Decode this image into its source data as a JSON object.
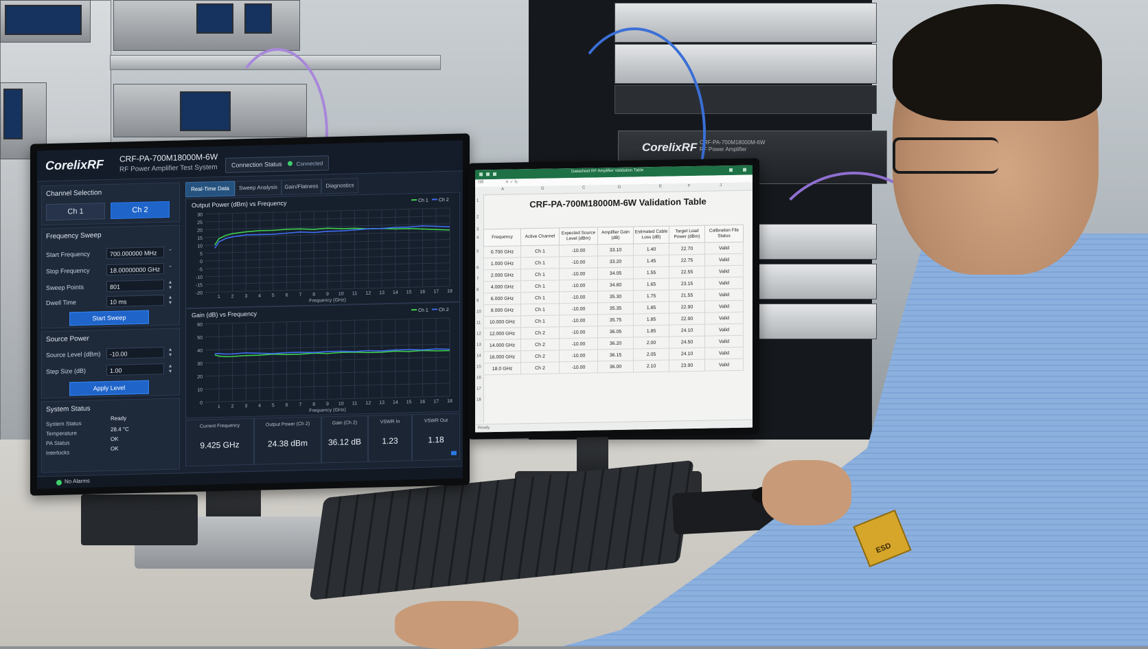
{
  "left_monitor": {
    "header": {
      "logo": "CorelixRF",
      "model": "CRF-PA-700M18000M-6W",
      "subtitle": "RF Power Amplifier Test System",
      "connection_label": "Connection Status",
      "connection_value": "Connected"
    },
    "channel_selection": {
      "title": "Channel Selection",
      "ch1": "Ch 1",
      "ch2": "Ch 2",
      "active": "Ch 2"
    },
    "frequency_sweep": {
      "title": "Frequency Sweep",
      "fields": [
        {
          "label": "Start Frequency",
          "value": "700.000000 MHz"
        },
        {
          "label": "Stop Frequency",
          "value": "18.00000000 GHz"
        },
        {
          "label": "Sweep Points",
          "value": "801"
        },
        {
          "label": "Dwell Time",
          "value": "10 ms"
        }
      ],
      "button": "Start Sweep"
    },
    "source_power": {
      "title": "Source Power",
      "fields": [
        {
          "label": "Source Level (dBm)",
          "value": "-10.00"
        },
        {
          "label": "Step Size (dB)",
          "value": "1.00"
        }
      ],
      "button": "Apply Level"
    },
    "system_status": {
      "title": "System Status",
      "rows": [
        {
          "label": "System Status",
          "value": "Ready"
        },
        {
          "label": "Temperature",
          "value": "28.4 °C"
        },
        {
          "label": "PA Status",
          "value": "OK"
        },
        {
          "label": "Interlocks",
          "value": "OK"
        }
      ]
    },
    "tabs": [
      "Real-Time Data",
      "Sweep Analysis",
      "Gain/Flatness",
      "Diagnostics"
    ],
    "readouts": [
      {
        "label": "Current Frequency",
        "value": "9.425 GHz"
      },
      {
        "label": "Output Power (Ch 2)",
        "value": "24.38 dBm"
      },
      {
        "label": "Gain (Ch 2)",
        "value": "36.12 dB"
      },
      {
        "label": "VSWR In",
        "value": "1.23"
      },
      {
        "label": "VSWR Out",
        "value": "1.18"
      }
    ],
    "footer": {
      "alarm": "No Alarms"
    }
  },
  "chart_data": [
    {
      "type": "line",
      "title": "Output Power (dBm) vs Frequency",
      "xlabel": "Frequency (GHz)",
      "ylabel": "",
      "xlim": [
        0,
        18
      ],
      "ylim": [
        -20,
        30
      ],
      "xticks": [
        1,
        2,
        3,
        4,
        5,
        6,
        7,
        8,
        9,
        10,
        11,
        12,
        13,
        14,
        15,
        16,
        17,
        18
      ],
      "yticks": [
        30,
        25,
        20,
        15,
        10,
        5,
        0,
        -5,
        -10,
        -15,
        -20
      ],
      "legend": "top-right",
      "grid": true,
      "x": [
        0.7,
        1,
        1.5,
        2,
        3,
        4,
        5,
        6,
        7,
        8,
        9,
        10,
        11,
        12,
        13,
        14,
        15,
        16,
        17,
        18
      ],
      "series": [
        {
          "name": "Ch 1",
          "color": "#3fd04f",
          "values": [
            10,
            14,
            16,
            17,
            18,
            18.5,
            18.5,
            19,
            19,
            18.5,
            19,
            18.5,
            18.5,
            18,
            18,
            17.5,
            17.5,
            17,
            16.5,
            16
          ]
        },
        {
          "name": "Ch 2",
          "color": "#3f6df0",
          "values": [
            8,
            12,
            14,
            15,
            16,
            16,
            16,
            16.5,
            17,
            16.5,
            17,
            17,
            17.5,
            18,
            18,
            18.5,
            18.5,
            19,
            18.5,
            18
          ]
        }
      ]
    },
    {
      "type": "line",
      "title": "Gain (dB) vs Frequency",
      "xlabel": "Frequency (GHz)",
      "ylabel": "",
      "xlim": [
        0,
        18
      ],
      "ylim": [
        0,
        60
      ],
      "xticks": [
        1,
        2,
        3,
        4,
        5,
        6,
        7,
        8,
        9,
        10,
        11,
        12,
        13,
        14,
        15,
        16,
        17,
        18
      ],
      "yticks": [
        60,
        50,
        40,
        30,
        20,
        10,
        0
      ],
      "legend": "top-right",
      "grid": true,
      "x": [
        0.7,
        1,
        1.5,
        2,
        3,
        4,
        5,
        6,
        7,
        8,
        9,
        10,
        11,
        12,
        13,
        14,
        15,
        16,
        17,
        18
      ],
      "series": [
        {
          "name": "Ch 1",
          "color": "#3fd04f",
          "values": [
            36,
            35,
            34.5,
            34.5,
            35,
            35,
            35.5,
            35,
            35,
            35.5,
            35,
            35.5,
            35.5,
            35,
            35,
            35.5,
            35,
            35.5,
            35,
            35
          ]
        },
        {
          "name": "Ch 2",
          "color": "#3f6df0",
          "values": [
            37,
            37,
            36.5,
            36.5,
            37,
            36.5,
            36,
            36.5,
            36.5,
            36,
            36.5,
            36.5,
            36,
            36.5,
            36,
            36.5,
            36.5,
            36,
            36.5,
            36
          ]
        }
      ]
    }
  ],
  "right_monitor": {
    "window_title": "Datasheet RF Amplifier Validation Table",
    "cell_ref": "I16",
    "columns_letters": [
      "A",
      "G",
      "C",
      "D",
      "E",
      "F",
      "J"
    ],
    "title": "CRF-PA-700M18000M-6W Validation Table",
    "table": {
      "headers": [
        "Frequency",
        "Active Channel",
        "Expected Source Level (dBm)",
        "Amplifier Gain (dB)",
        "Estimated Cable Loss (dB)",
        "Target Load Power (dBm)",
        "Calibration File Status"
      ],
      "rows": [
        [
          "0.700 GHz",
          "Ch 1",
          "-10.00",
          "33.10",
          "1.40",
          "22.70",
          "Valid"
        ],
        [
          "1.000 GHz",
          "Ch 1",
          "-10.00",
          "33.20",
          "1.45",
          "22.75",
          "Valid"
        ],
        [
          "2.000 GHz",
          "Ch 1",
          "-10.00",
          "34.05",
          "1.55",
          "22.55",
          "Valid"
        ],
        [
          "4.000 GHz",
          "Ch 1",
          "-10.00",
          "34.80",
          "1.65",
          "23.15",
          "Valid"
        ],
        [
          "6.000 GHz",
          "Ch 1",
          "-10.00",
          "35.30",
          "1.75",
          "21.55",
          "Valid"
        ],
        [
          "8.000 GHz",
          "Ch 1",
          "-10.00",
          "35.35",
          "1.85",
          "22.90",
          "Valid"
        ],
        [
          "10.000 GHz",
          "Ch 1",
          "-10.00",
          "35.75",
          "1.85",
          "22.90",
          "Valid"
        ],
        [
          "12.000 GHz",
          "Ch 2",
          "-10.00",
          "36.05",
          "1.85",
          "24.10",
          "Valid"
        ],
        [
          "14.000 GHz",
          "Ch 2",
          "-10.00",
          "36.20",
          "2.00",
          "24.50",
          "Valid"
        ],
        [
          "16.000 GHz",
          "Ch 2",
          "-10.00",
          "36.15",
          "2.05",
          "24.10",
          "Valid"
        ],
        [
          "18.0 GHz",
          "Ch 2",
          "-10.00",
          "36.00",
          "2.10",
          "23.90",
          "Valid"
        ]
      ]
    },
    "status_bar": "Ready"
  },
  "hardware": {
    "amp_brand": "CorelixRF",
    "amp_model": "CRF-PA-700M18000M-6W",
    "amp_sub": "RF Power Amplifier",
    "esd_patch": "ESD"
  },
  "colors": {
    "app_bg": "#1a2332",
    "accent_blue": "#1f64c9",
    "ok_green": "#3fd06b",
    "excel_green": "#1e7145"
  }
}
